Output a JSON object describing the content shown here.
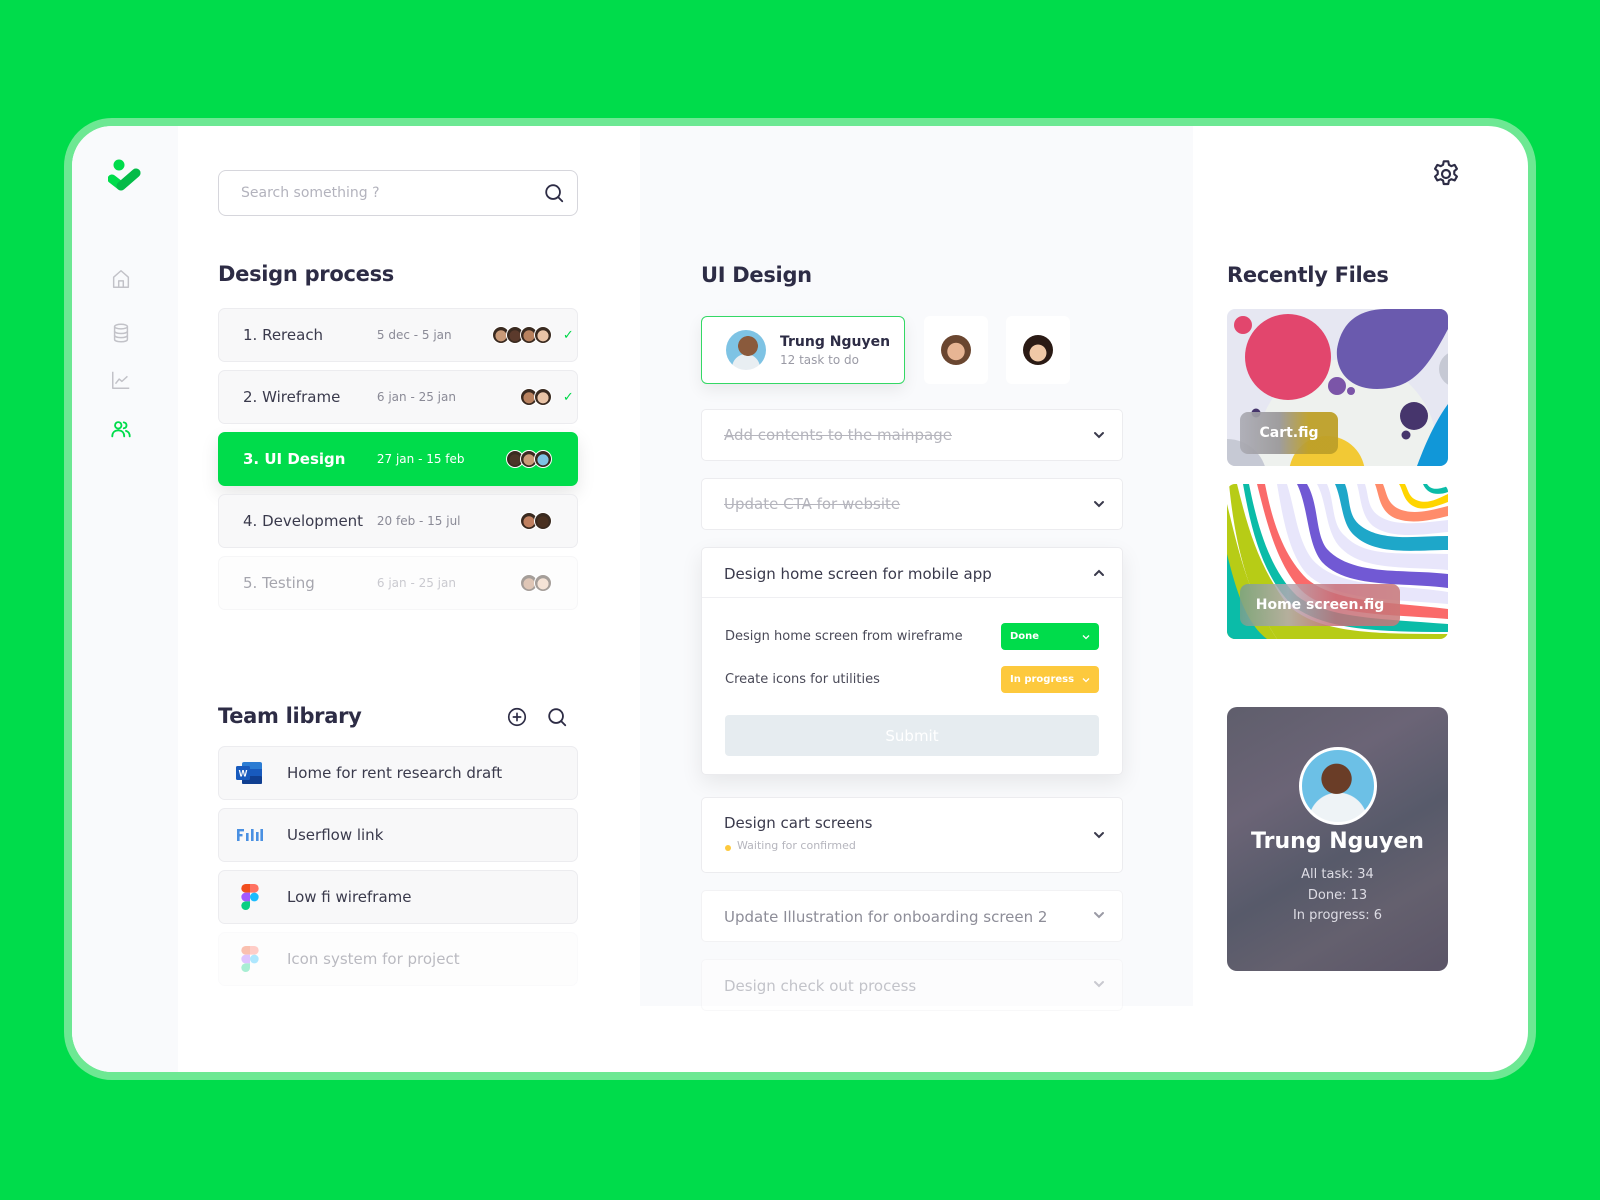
{
  "colors": {
    "brand": "#00dc4b",
    "done": "#00dc4b",
    "in_progress": "#fdc93d",
    "waiting_dot": "#fdc93d"
  },
  "sidebar": {
    "items": [
      {
        "name": "home",
        "icon": "home-icon",
        "active": false
      },
      {
        "name": "database",
        "icon": "database-icon",
        "active": false
      },
      {
        "name": "analytics",
        "icon": "chart-line-icon",
        "active": false
      },
      {
        "name": "team",
        "icon": "users-icon",
        "active": true
      }
    ]
  },
  "search": {
    "placeholder": "Search something ?",
    "value": ""
  },
  "design_process": {
    "title": "Design process",
    "steps": [
      {
        "name": "1. Rereach",
        "dates": "5 dec - 5 jan",
        "avatars": 4,
        "completed": true,
        "state": "normal"
      },
      {
        "name": "2. Wireframe",
        "dates": "6 jan - 25 jan",
        "avatars": 2,
        "completed": true,
        "state": "normal"
      },
      {
        "name": "3. UI Design",
        "dates": "27 jan - 15 feb",
        "avatars": 3,
        "completed": false,
        "state": "active"
      },
      {
        "name": "4. Development",
        "dates": "20 feb - 15 jul",
        "avatars": 2,
        "completed": false,
        "state": "normal"
      },
      {
        "name": "5. Testing",
        "dates": "6 jan - 25 jan",
        "avatars": 2,
        "completed": false,
        "state": "faded"
      }
    ],
    "check_glyph": "✓"
  },
  "team_library": {
    "title": "Team library",
    "items": [
      {
        "label": "Home for rent research draft",
        "icon": "word-icon"
      },
      {
        "label": "Userflow link",
        "icon": "flowmapp-icon"
      },
      {
        "label": "Low fi wireframe",
        "icon": "figma-icon"
      },
      {
        "label": "Icon system for project",
        "icon": "figma-icon"
      }
    ]
  },
  "ui_design": {
    "title": "UI Design",
    "selected_member": {
      "name": "Trung Nguyen",
      "tasks": "12 task to do"
    },
    "other_members": 2,
    "tasks": [
      {
        "title": "Add contents to the mainpage",
        "state": "done"
      },
      {
        "title": "Update CTA for website",
        "state": "done"
      },
      {
        "title": "Design home screen for mobile app",
        "state": "expanded",
        "subtasks": [
          {
            "label": "Design home screen from wireframe",
            "status": "Done"
          },
          {
            "label": "Create icons for utilities",
            "status": "In progress"
          }
        ],
        "submit_label": "Submit"
      },
      {
        "title": "Design cart screens",
        "state": "waiting",
        "note": "Waiting for confirmed"
      },
      {
        "title": "Update Illustration for onboarding screen 2",
        "state": "light"
      },
      {
        "title": "Design check out process",
        "state": "lighter"
      }
    ]
  },
  "recent_files": {
    "title": "Recently Files",
    "files": [
      {
        "name": "Cart.fig"
      },
      {
        "name": "Home screen.fig"
      }
    ]
  },
  "profile": {
    "name": "Trung Nguyen",
    "all_task": "All task: 34",
    "done": "Done: 13",
    "in_progress": "In progress: 6"
  }
}
